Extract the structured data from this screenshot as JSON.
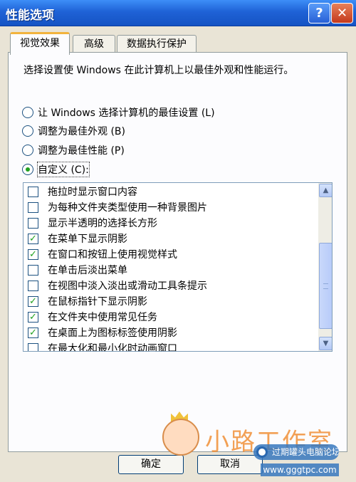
{
  "window": {
    "title": "性能选项",
    "help_glyph": "?",
    "close_glyph": "✕"
  },
  "tabs": [
    {
      "label": "视觉效果",
      "active": true
    },
    {
      "label": "高级",
      "active": false
    },
    {
      "label": "数据执行保护",
      "active": false
    }
  ],
  "intro": "选择设置使 Windows 在此计算机上以最佳外观和性能运行。",
  "radios": [
    {
      "label": "让 Windows 选择计算机的最佳设置 (L)",
      "selected": false
    },
    {
      "label": "调整为最佳外观 (B)",
      "selected": false
    },
    {
      "label": "调整为最佳性能 (P)",
      "selected": false
    },
    {
      "label": "自定义 (C):",
      "selected": true
    }
  ],
  "effects": [
    {
      "label": "拖拉时显示窗口内容",
      "checked": false
    },
    {
      "label": "为每种文件夹类型使用一种背景图片",
      "checked": false
    },
    {
      "label": "显示半透明的选择长方形",
      "checked": false
    },
    {
      "label": "在菜单下显示阴影",
      "checked": true
    },
    {
      "label": "在窗口和按钮上使用视觉样式",
      "checked": true
    },
    {
      "label": "在单击后淡出菜单",
      "checked": false
    },
    {
      "label": "在视图中淡入淡出或滑动工具条提示",
      "checked": false
    },
    {
      "label": "在鼠标指针下显示阴影",
      "checked": true
    },
    {
      "label": "在文件夹中使用常见任务",
      "checked": true
    },
    {
      "label": "在桌面上为图标标签使用阴影",
      "checked": true
    },
    {
      "label": "在最大化和最小化时动画窗口",
      "checked": false
    }
  ],
  "check_glyph": "✓",
  "scroll": {
    "up_glyph": "▲",
    "down_glyph": "▼"
  },
  "buttons": {
    "ok": "确定",
    "cancel": "取消"
  },
  "watermark": {
    "brand": "小路工作室",
    "logo_text": "过期罐头电脑论坛",
    "url": "www.gggtpc.com"
  }
}
